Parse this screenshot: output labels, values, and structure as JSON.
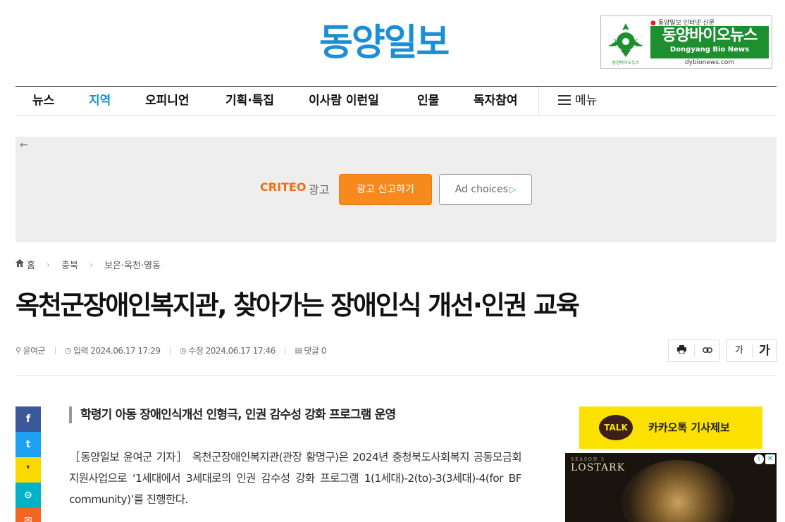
{
  "site": {
    "logo": "동양일보"
  },
  "bio_banner": {
    "tagline_dot": "●",
    "tagline": "동양일보 인터넷 신문",
    "name": "동양바이오뉴스",
    "name_en": "Dongyang Bio News",
    "url": "dybionews.com"
  },
  "nav": {
    "items": [
      {
        "label": "뉴스",
        "active": false
      },
      {
        "label": "지역",
        "active": true
      },
      {
        "label": "오피니언",
        "active": false
      },
      {
        "label": "기획·특집",
        "active": false
      },
      {
        "label": "이사람 이런일",
        "active": false
      },
      {
        "label": "인물",
        "active": false
      },
      {
        "label": "독자참여",
        "active": false
      }
    ],
    "menu_label": "메뉴"
  },
  "ad": {
    "back_arrow": "←",
    "brand": "CRITEO",
    "ad_label": "광고",
    "report_label": "광고 신고하기",
    "adchoices_label": "Ad choices",
    "adchoices_icon": "▷"
  },
  "breadcrumb": {
    "home": "홈",
    "level1": "충북",
    "level2": "보은·옥천·영동",
    "separator": "›"
  },
  "article": {
    "title": "옥천군장애인복지관, 찾아가는 장애인식 개선·인권 교육",
    "author": "윤여군",
    "input_label": "입력",
    "input_date": "2024.06.17 17:29",
    "modified_label": "수정",
    "modified_date": "2024.06.17 17:46",
    "comments_label": "댓글",
    "comments_count": "0",
    "subtitle": "학령기 아동 장애인식개선 인형극, 인권 감수성 강화 프로그램 운영",
    "body": "［동양일보 윤여군 기자］ 옥천군장애인복지관(관장 황명구)은 2024년 충청북도사회복지 공동모금회 지원사업으로 ‘1세대에서 3세대로의 인권 감수성 강화 프로그램 1(1세대)-2(to)-3(3세대)-4(for BF community)’를 진행한다."
  },
  "tools": {
    "print_icon": "print-icon",
    "link_icon": "link-icon",
    "font_small": "가",
    "font_large": "가"
  },
  "share": {
    "facebook": "f",
    "twitter": "t",
    "kakao": "❜",
    "link": "⊝",
    "email": "✉",
    "colors": {
      "facebook": "#3b5998",
      "twitter": "#1da1f2",
      "kakao": "#f9d900",
      "link": "#00b2c7",
      "email": "#f26522"
    }
  },
  "sidebar": {
    "kakao_talk": "TALK",
    "kakao_label": "카카오톡 기사제보",
    "game_ad_season": "SEASON 3",
    "game_ad_title": "LOSTARK",
    "ad_info": "i",
    "ad_close": "✕"
  },
  "colors": {
    "brand_blue": "#1a8fd6",
    "bio_green": "#1d8f2f",
    "criteo_orange": "#f06e13",
    "report_orange": "#f78a1d",
    "kakao_yellow": "#fae100"
  }
}
